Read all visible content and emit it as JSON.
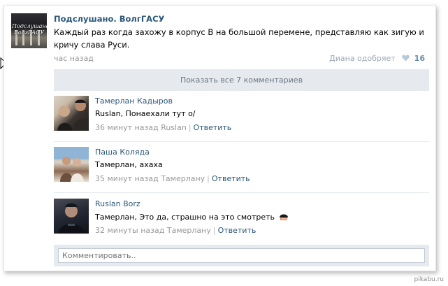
{
  "post": {
    "group_name": "Подслушано. ВолгГАСУ",
    "avatar_text_line1": "Подслушано",
    "avatar_text_line2": "ВолгГАСУ",
    "text": "Каждый раз когда захожу в корпус В на большой перемене, представляю как зигую и кричу слава Руси.",
    "time": "час назад",
    "liked_by": "Диана одобряет",
    "likes_count": "16"
  },
  "show_all_comments": "Показать все 7 комментариев",
  "comments": [
    {
      "author": "Тамерлан Кадыров",
      "text": "Ruslan, Понаехали тут о/",
      "time": "36 минут назад",
      "reply_to": "Ruslan",
      "separator": "|",
      "reply_label": "Ответить"
    },
    {
      "author": "Паша Коляда",
      "text": "Тамерлан, ахаха",
      "time": "35 минут назад",
      "reply_to": "Тамерлану",
      "separator": "|",
      "reply_label": "Ответить"
    },
    {
      "author": "Ruslan Borz",
      "text": "Тамерлан, Это да, страшно на это смотреть",
      "time": "32 минуты назад",
      "reply_to": "Тамерлану",
      "separator": "|",
      "reply_label": "Ответить"
    }
  ],
  "comment_input": {
    "placeholder": "Комментировать.."
  },
  "watermark": "pikabu.ru",
  "colors": {
    "link": "#2b587a",
    "muted": "#999999",
    "bar_background": "#e6e9ed",
    "heart": "#b9c9d9"
  },
  "icons": {
    "like": "heart-icon",
    "emoji": "helmet-emoji-icon",
    "cursor": "mouse-cursor-icon"
  }
}
